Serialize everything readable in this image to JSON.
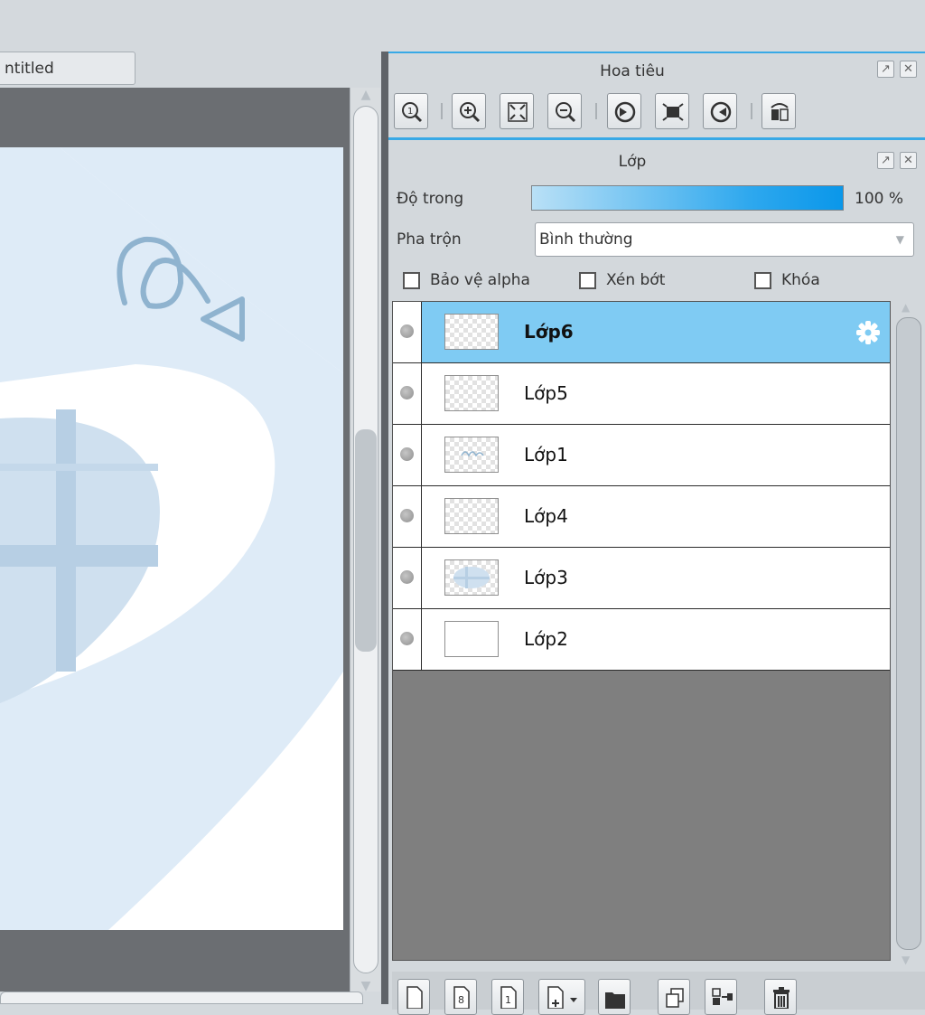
{
  "document": {
    "tab_title": "ntitled"
  },
  "navigator": {
    "title": "Hoa tiêu"
  },
  "layers_panel": {
    "title": "Lớp",
    "opacity_label": "Độ trong",
    "opacity_value": "100 %",
    "opacity_fraction": 1.0,
    "blend_label": "Pha trộn",
    "blend_value": "Bình thường",
    "protect_alpha_label": "Bảo vệ alpha",
    "clipping_label": "Xén bớt",
    "lock_label": "Khóa",
    "layers": [
      {
        "name": "Lớp6",
        "selected": true
      },
      {
        "name": "Lớp5",
        "selected": false
      },
      {
        "name": "Lớp1",
        "selected": false
      },
      {
        "name": "Lớp4",
        "selected": false
      },
      {
        "name": "Lớp3",
        "selected": false
      },
      {
        "name": "Lớp2",
        "selected": false
      }
    ]
  },
  "colors": {
    "accent": "#38a9e6",
    "selected_row": "#7fcbf3",
    "canvas_shape": "#cfe0ef",
    "stroke": "#8fb3cf"
  }
}
